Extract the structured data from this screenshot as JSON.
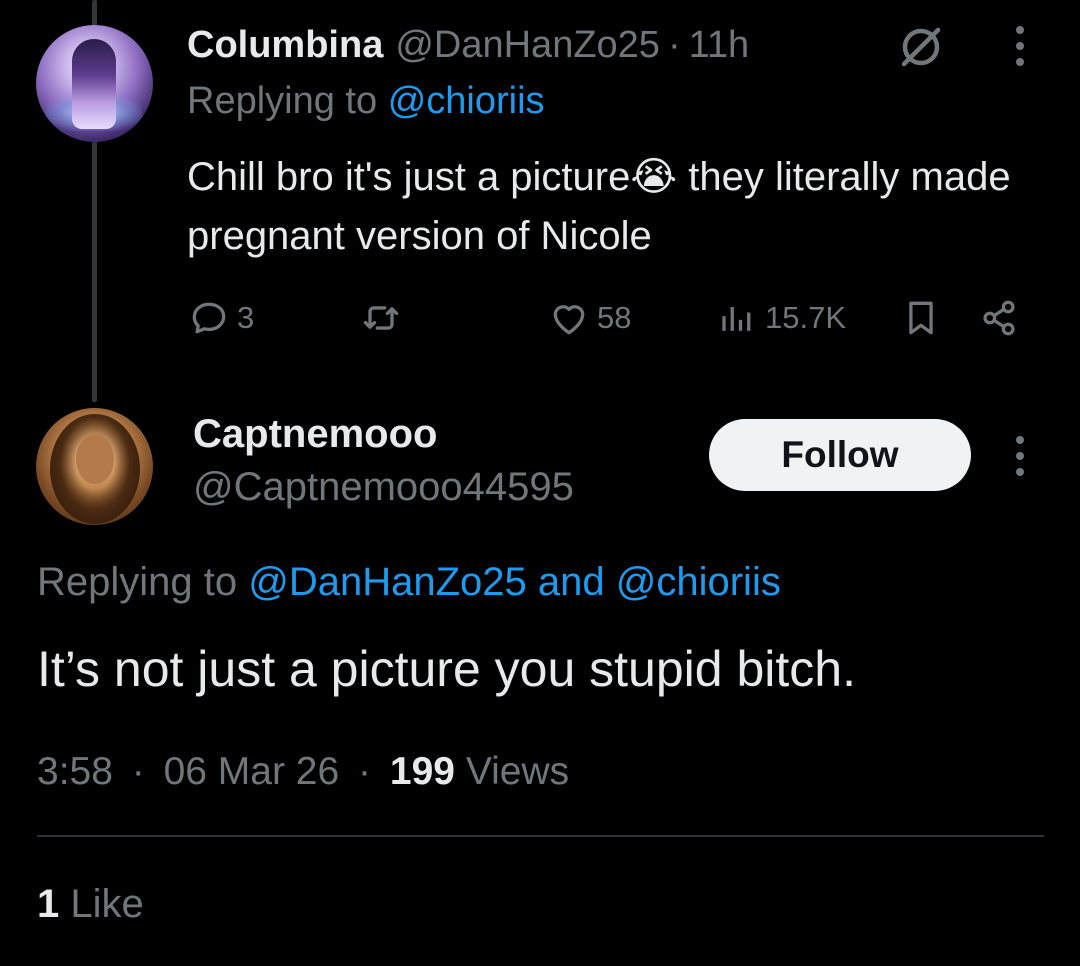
{
  "tweet1": {
    "display_name": "Columbina",
    "handle": "@DanHanZo25",
    "separator": "·",
    "time": "11h",
    "replying_prefix": "Replying to",
    "replying_handle": "@chioriis",
    "body_before_emoji": "Chill bro it's just a picture",
    "emoji": "😭",
    "body_after_emoji": " they literally made pregnant version of Nicole",
    "actions": {
      "replies": "3",
      "retweets": "",
      "likes": "58",
      "views": "15.7K"
    },
    "icons": [
      "grok-icon",
      "more-icon",
      "reply-icon",
      "retweet-icon",
      "heart-icon",
      "views-icon",
      "bookmark-icon",
      "share-icon"
    ]
  },
  "tweet2": {
    "display_name": "Captnemooo",
    "handle": "@Captnemooo44595",
    "follow_label": "Follow",
    "replying_prefix": "Replying to",
    "replying_handles": "@DanHanZo25 and @chioriis",
    "body": "It’s not just a picture you stupid bitch.",
    "time": "3:58",
    "date": "06 Mar 26",
    "separator": "·",
    "views_count": "199",
    "views_label": "Views",
    "likes_count": "1",
    "likes_label": "Like"
  },
  "colors": {
    "background": "#000000",
    "text_primary": "#e7e9ea",
    "text_secondary": "#71767b",
    "link": "#1d9bf0",
    "divider": "#2f3336",
    "follow_bg": "#eff3f4"
  }
}
